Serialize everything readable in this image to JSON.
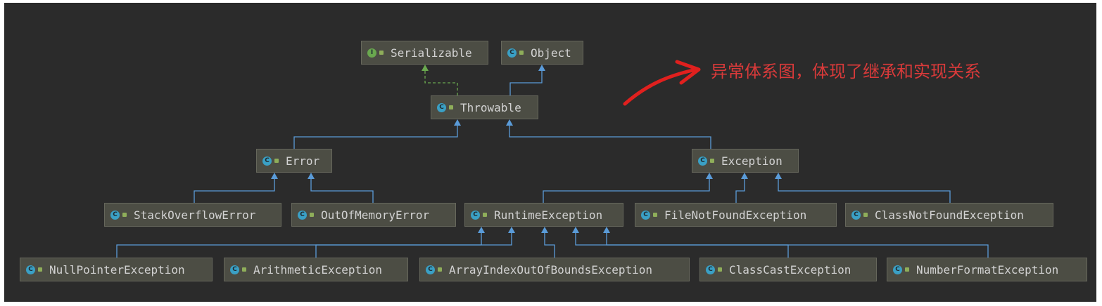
{
  "diagram": {
    "nodes": [
      {
        "id": "Serializable",
        "label": "Serializable",
        "kind": "interface"
      },
      {
        "id": "Object",
        "label": "Object",
        "kind": "class"
      },
      {
        "id": "Throwable",
        "label": "Throwable",
        "kind": "class"
      },
      {
        "id": "Error",
        "label": "Error",
        "kind": "class"
      },
      {
        "id": "Exception",
        "label": "Exception",
        "kind": "class"
      },
      {
        "id": "StackOverflowError",
        "label": "StackOverflowError",
        "kind": "class"
      },
      {
        "id": "OutOfMemoryError",
        "label": "OutOfMemoryError",
        "kind": "class"
      },
      {
        "id": "RuntimeException",
        "label": "RuntimeException",
        "kind": "class"
      },
      {
        "id": "FileNotFoundException",
        "label": "FileNotFoundException",
        "kind": "class"
      },
      {
        "id": "ClassNotFoundException",
        "label": "ClassNotFoundException",
        "kind": "class"
      },
      {
        "id": "NullPointerException",
        "label": "NullPointerException",
        "kind": "class"
      },
      {
        "id": "ArithmeticException",
        "label": "ArithmeticException",
        "kind": "class"
      },
      {
        "id": "ArrayIndexOutOfBoundsException",
        "label": "ArrayIndexOutOfBoundsException",
        "kind": "class"
      },
      {
        "id": "ClassCastException",
        "label": "ClassCastException",
        "kind": "class"
      },
      {
        "id": "NumberFormatException",
        "label": "NumberFormatException",
        "kind": "class"
      }
    ],
    "edges": [
      {
        "from": "Throwable",
        "to": "Serializable",
        "type": "implements"
      },
      {
        "from": "Throwable",
        "to": "Object",
        "type": "extends"
      },
      {
        "from": "Error",
        "to": "Throwable",
        "type": "extends"
      },
      {
        "from": "Exception",
        "to": "Throwable",
        "type": "extends"
      },
      {
        "from": "StackOverflowError",
        "to": "Error",
        "type": "extends"
      },
      {
        "from": "OutOfMemoryError",
        "to": "Error",
        "type": "extends"
      },
      {
        "from": "RuntimeException",
        "to": "Exception",
        "type": "extends"
      },
      {
        "from": "FileNotFoundException",
        "to": "Exception",
        "type": "extends"
      },
      {
        "from": "ClassNotFoundException",
        "to": "Exception",
        "type": "extends"
      },
      {
        "from": "NullPointerException",
        "to": "RuntimeException",
        "type": "extends"
      },
      {
        "from": "ArithmeticException",
        "to": "RuntimeException",
        "type": "extends"
      },
      {
        "from": "ArrayIndexOutOfBoundsException",
        "to": "RuntimeException",
        "type": "extends"
      },
      {
        "from": "ClassCastException",
        "to": "RuntimeException",
        "type": "extends"
      },
      {
        "from": "NumberFormatException",
        "to": "RuntimeException",
        "type": "extends"
      }
    ],
    "annotation": "异常体系图，体现了继承和实现关系"
  },
  "colors": {
    "panel_bg": "#2b2b2b",
    "node_bg": "#4c4d44",
    "extends_line": "#5a9bd8",
    "implements_line": "#6aa84f",
    "annotation": "#d93a3a",
    "class_icon": "#3aa0c5",
    "interface_icon": "#6aa84f"
  },
  "icons": {
    "class": "class-c-icon",
    "interface": "interface-i-icon"
  }
}
